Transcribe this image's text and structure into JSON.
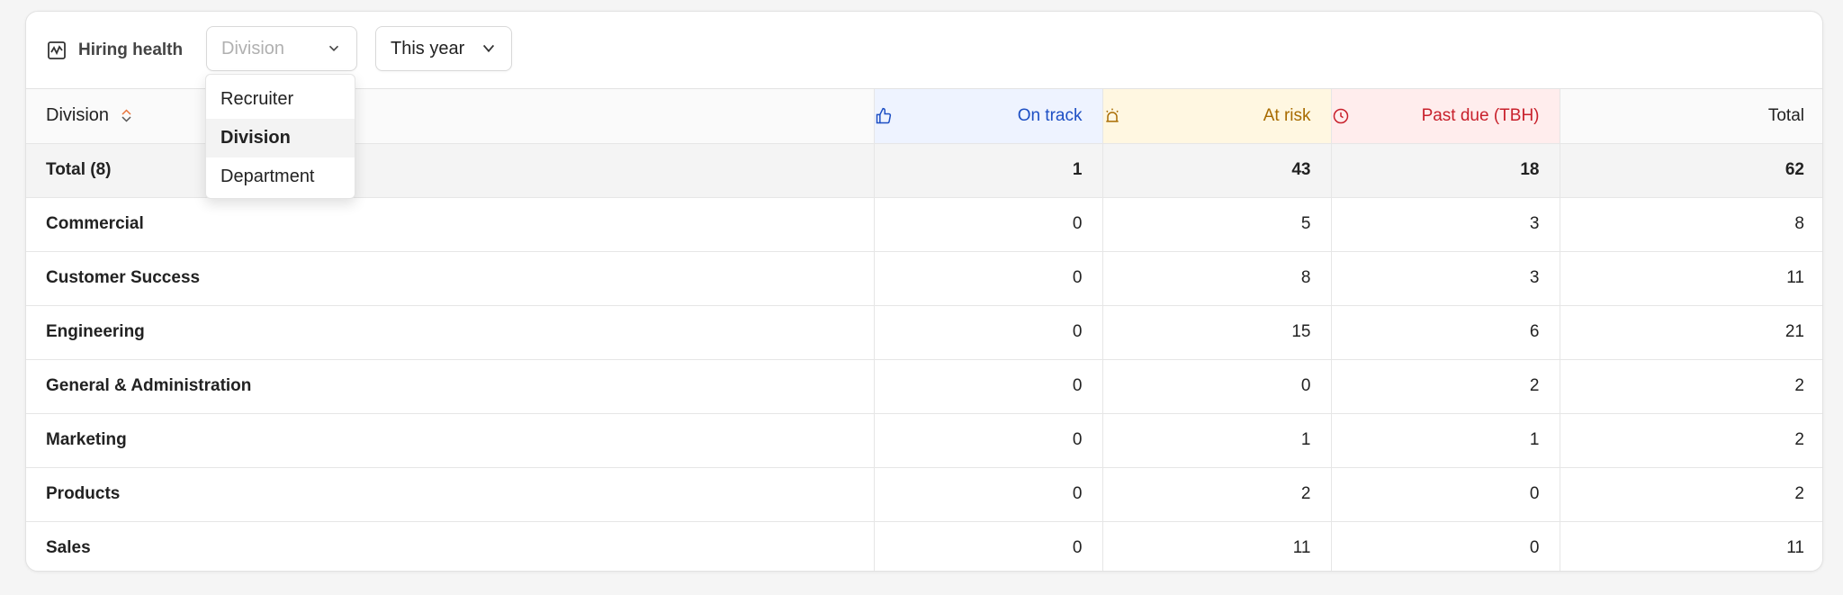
{
  "header": {
    "title": "Hiring health",
    "group_by": {
      "placeholder": "Division"
    },
    "period": {
      "value": "This year"
    }
  },
  "group_menu": {
    "options": [
      "Recruiter",
      "Division",
      "Department"
    ],
    "selected": "Division"
  },
  "columns": {
    "name": "Division",
    "on_track": "On track",
    "at_risk": "At risk",
    "past_due": "Past due (TBH)",
    "total": "Total"
  },
  "colors": {
    "on_track": "#1d4fc4",
    "at_risk": "#a86b00",
    "past_due": "#c8202b",
    "sort_active": "#e8743b"
  },
  "total_row": {
    "name": "Total (8)",
    "on_track": "1",
    "at_risk": "43",
    "past_due": "18",
    "total": "62"
  },
  "rows": [
    {
      "name": "Commercial",
      "on_track": "0",
      "at_risk": "5",
      "past_due": "3",
      "total": "8"
    },
    {
      "name": "Customer Success",
      "on_track": "0",
      "at_risk": "8",
      "past_due": "3",
      "total": "11"
    },
    {
      "name": "Engineering",
      "on_track": "0",
      "at_risk": "15",
      "past_due": "6",
      "total": "21"
    },
    {
      "name": "General & Administration",
      "on_track": "0",
      "at_risk": "0",
      "past_due": "2",
      "total": "2"
    },
    {
      "name": "Marketing",
      "on_track": "0",
      "at_risk": "1",
      "past_due": "1",
      "total": "2"
    },
    {
      "name": "Products",
      "on_track": "0",
      "at_risk": "2",
      "past_due": "0",
      "total": "2"
    },
    {
      "name": "Sales",
      "on_track": "0",
      "at_risk": "11",
      "past_due": "0",
      "total": "11"
    }
  ]
}
